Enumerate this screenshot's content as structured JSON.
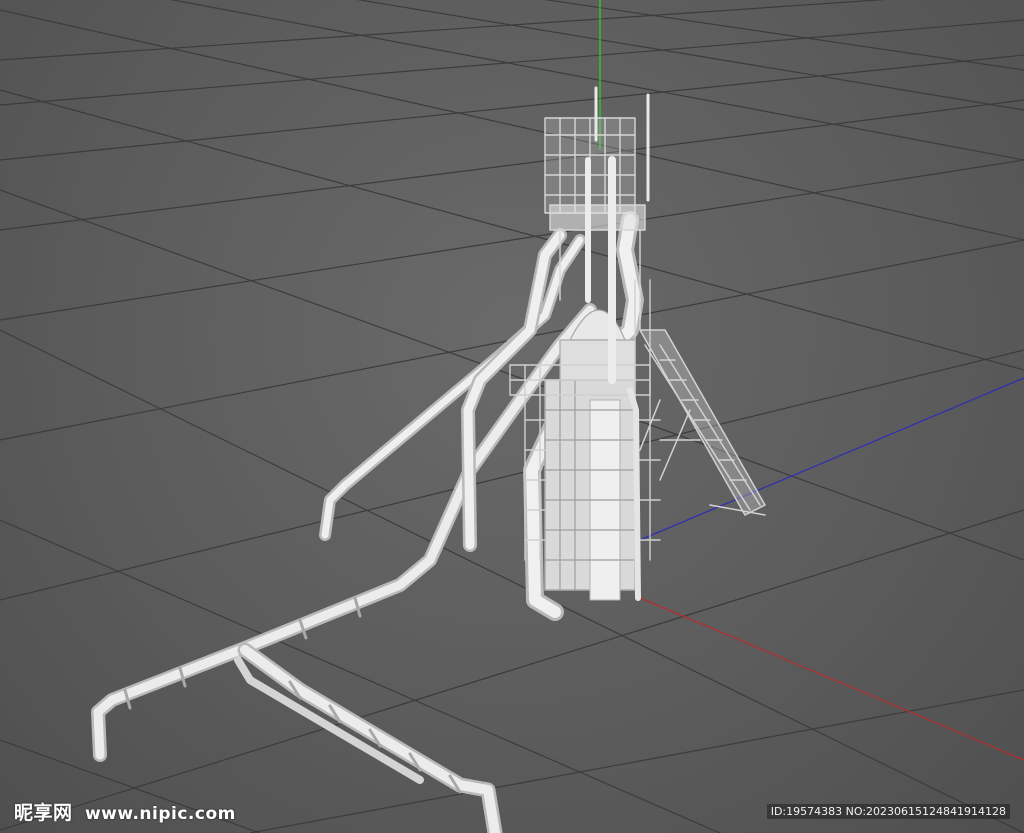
{
  "viewport": {
    "background_color": "#5e5e5e",
    "grid_color": "#3c3c3c",
    "model_color": "#e6e6e6"
  },
  "axes": {
    "x_axis_color": "#b03030",
    "y_axis_color": "#30c030",
    "z_axis_color": "#3030b0"
  },
  "model": {
    "name_icon": "blast-furnace-model-icon"
  },
  "watermark": {
    "brand": "昵享网",
    "site": "www.nipic.com",
    "id_text": "ID:19574383 NO:20230615124841914128"
  }
}
